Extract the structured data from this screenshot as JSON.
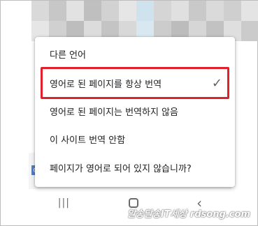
{
  "menu": {
    "items": [
      {
        "label": "다른 언어"
      },
      {
        "label": "영어로 된 페이지를 항상 번역",
        "checked": true
      },
      {
        "label": "영어로 된 페이지는 번역하지 않음"
      },
      {
        "label": "이 사이트 번역 안함"
      },
      {
        "label": "페이지가 영어로 되어 있지 않습니까?"
      }
    ],
    "check_icon": "✓",
    "highlight_color": "#e0202a"
  },
  "navbar": {
    "recents_icon": "|||",
    "back_icon": "‹"
  },
  "background": {
    "g_chip": "G"
  },
  "watermark": "알송달송IT세상 rdsong.com"
}
